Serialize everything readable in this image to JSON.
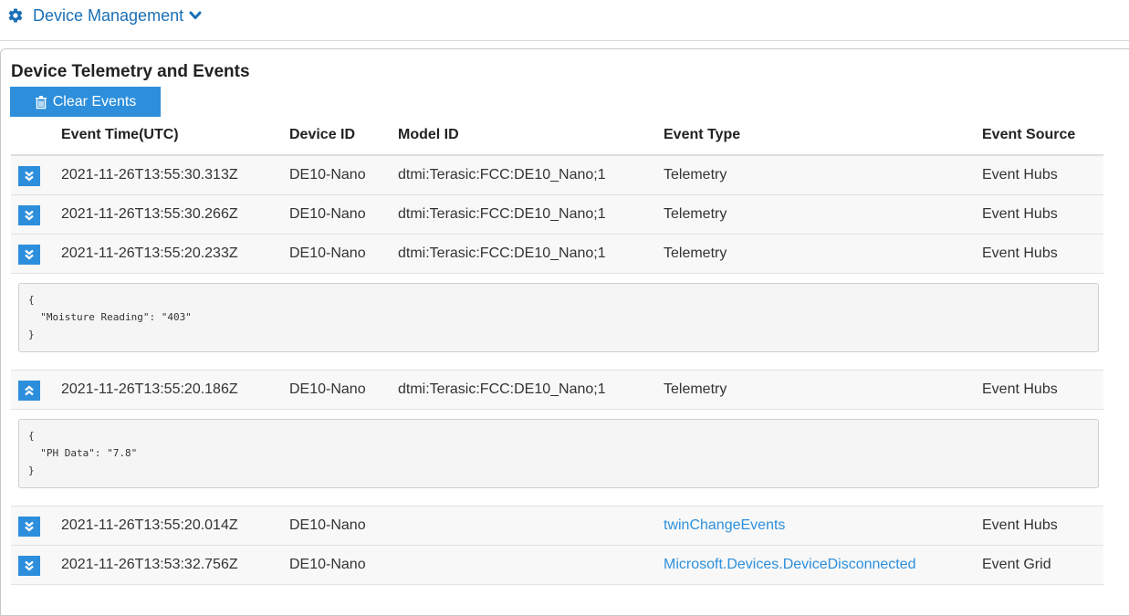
{
  "nav": {
    "title": "Device Management"
  },
  "panel": {
    "title": "Device Telemetry and Events",
    "clear_label": "Clear Events"
  },
  "columns": [
    "Event Time(UTC)",
    "Device ID",
    "Model ID",
    "Event Type",
    "Event Source"
  ],
  "events": [
    {
      "time": "2021-11-26T13:55:30.313Z",
      "device": "DE10-Nano",
      "model": "dtmi:Terasic:FCC:DE10_Nano;1",
      "type": "Telemetry",
      "source": "Event Hubs"
    },
    {
      "time": "2021-11-26T13:55:30.266Z",
      "device": "DE10-Nano",
      "model": "dtmi:Terasic:FCC:DE10_Nano;1",
      "type": "Telemetry",
      "source": "Event Hubs"
    },
    {
      "time": "2021-11-26T13:55:20.233Z",
      "device": "DE10-Nano",
      "model": "dtmi:Terasic:FCC:DE10_Nano;1",
      "type": "Telemetry",
      "source": "Event Hubs",
      "payload": "{\n  \"Moisture Reading\": \"403\"\n}"
    },
    {
      "time": "2021-11-26T13:55:20.186Z",
      "device": "DE10-Nano",
      "model": "dtmi:Terasic:FCC:DE10_Nano;1",
      "type": "Telemetry",
      "source": "Event Hubs",
      "payload": "{\n  \"PH Data\": \"7.8\"\n}"
    },
    {
      "time": "2021-11-26T13:55:20.014Z",
      "device": "DE10-Nano",
      "model": "",
      "type": "twinChangeEvents",
      "source": "Event Hubs"
    },
    {
      "time": "2021-11-26T13:53:32.756Z",
      "device": "DE10-Nano",
      "model": "",
      "type": "Microsoft.Devices.DeviceDisconnected",
      "source": "Event Grid"
    }
  ],
  "icons": {
    "gear": "gear-icon",
    "chevron": "chevron-down-icon",
    "trash": "trash-icon",
    "expand": "double-chevron-down-icon",
    "collapse": "double-chevron-up-icon"
  },
  "colors": {
    "accent": "#2d8fdc",
    "nav_link": "#1a6fb5"
  }
}
